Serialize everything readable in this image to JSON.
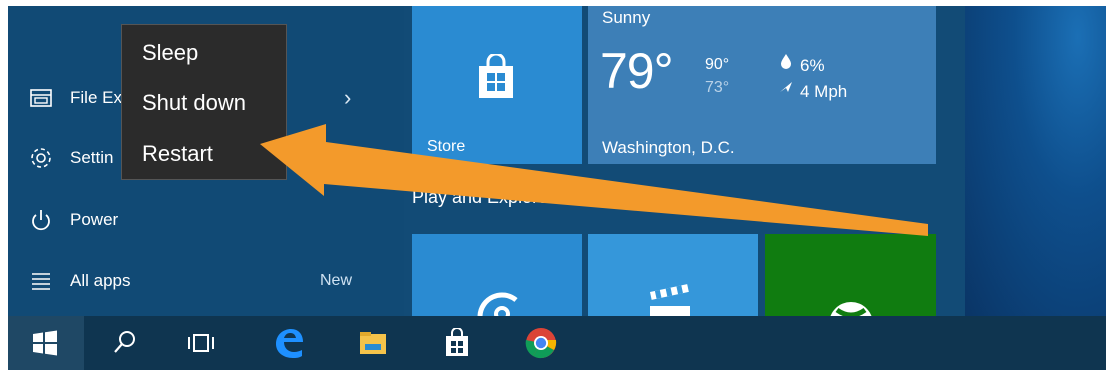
{
  "start_menu": {
    "items": [
      {
        "label": "File Ex",
        "icon": "file-explorer-icon"
      },
      {
        "label": "Settin",
        "icon": "gear-icon"
      },
      {
        "label": "Power",
        "icon": "power-icon"
      },
      {
        "label": "All apps",
        "icon": "all-apps-icon"
      }
    ],
    "new_badge": "New",
    "chevron": "›"
  },
  "power_flyout": {
    "items": [
      "Sleep",
      "Shut down",
      "Restart"
    ]
  },
  "tiles": {
    "store_label": "Store",
    "group_title": "Play and Explore"
  },
  "weather": {
    "condition": "Sunny",
    "temperature": "79°",
    "high": "90°",
    "low": "73°",
    "precipitation": "6%",
    "wind": "4 Mph",
    "city": "Washington, D.C."
  },
  "taskbar": {
    "icons": [
      "windows-start-icon",
      "search-icon",
      "task-view-icon",
      "edge-icon",
      "file-explorer-icon",
      "store-icon",
      "chrome-icon"
    ]
  },
  "colors": {
    "annotation_arrow": "#f39a2b",
    "xbox_tile": "#107c10",
    "store_tile": "#2a8bd2"
  }
}
